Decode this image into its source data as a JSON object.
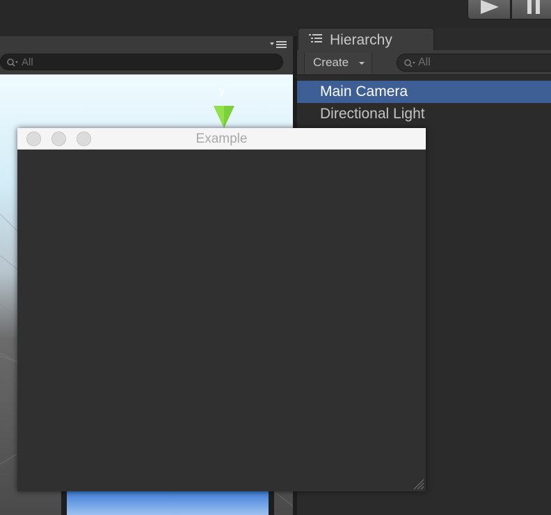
{
  "toolbar": {
    "play_icon": "play-icon",
    "pause_icon": "pause-icon"
  },
  "scene": {
    "search": {
      "placeholder": "All"
    },
    "gizmo_axis_label": "y",
    "menu_icon": "panel-menu-icon"
  },
  "hierarchy": {
    "tab_label": "Hierarchy",
    "tab_icon": "hierarchy-list-icon",
    "create_label": "Create",
    "search": {
      "placeholder": "All"
    },
    "items": [
      {
        "label": "Main Camera",
        "selected": true
      },
      {
        "label": "Directional Light",
        "selected": false
      }
    ]
  },
  "window": {
    "title": "Example"
  },
  "colors": {
    "selection": "#3e5f96",
    "gizmo_green": "#7cd03a",
    "panel_bg": "#2b2b2b",
    "window_body": "#303030"
  }
}
